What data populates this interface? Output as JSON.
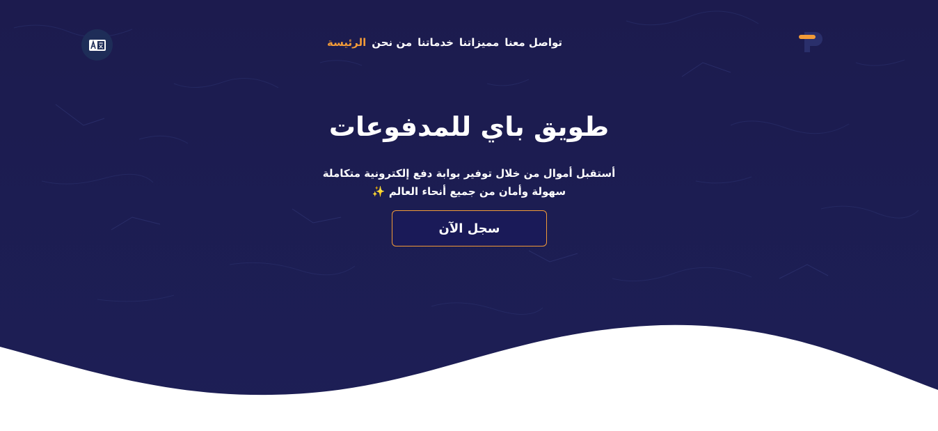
{
  "nav": {
    "logo_icon": "tuwaiq-pay-logo",
    "language_icon": "translate-icon",
    "links": [
      {
        "label": "الرئيسة",
        "active": true
      },
      {
        "label": "من نحن",
        "active": false
      },
      {
        "label": "خدماتنا",
        "active": false
      },
      {
        "label": "مميزاتنا",
        "active": false
      },
      {
        "label": "تواصل معنا",
        "active": false
      }
    ]
  },
  "hero": {
    "title": "طويق باي للمدفوعات",
    "subtitle_line1": "أستقبل أموال من خلال توفير بوابة دفع إلكترونية متكاملة",
    "subtitle_line2": "سهولة وأمان من جميع أنحاء العالم",
    "subtitle_emoji": "✨",
    "cta_label": "سجل الآن"
  },
  "colors": {
    "hero_background": "#1c1b4f",
    "accent": "#f29b38",
    "button_background": "#1a1a58",
    "wave": "#ffffff",
    "language_button": "#1e2d58"
  }
}
